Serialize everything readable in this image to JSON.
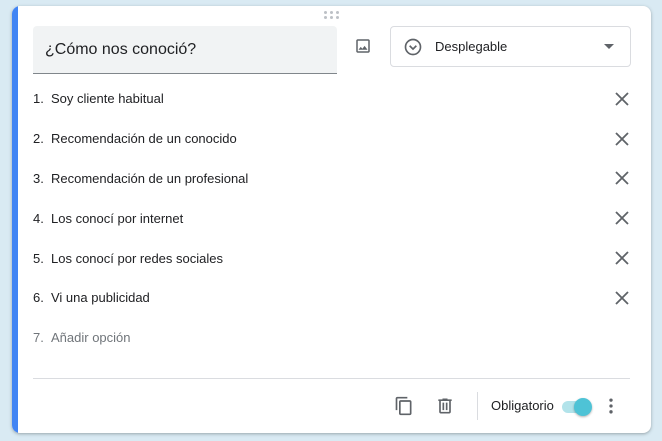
{
  "question": {
    "title": "¿Cómo nos conoció?",
    "type_label": "Desplegable"
  },
  "options": [
    {
      "num": "1.",
      "text": "Soy cliente habitual"
    },
    {
      "num": "2.",
      "text": "Recomendación de un conocido"
    },
    {
      "num": "3.",
      "text": "Recomendación de un profesional"
    },
    {
      "num": "4.",
      "text": "Los conocí por internet"
    },
    {
      "num": "5.",
      "text": "Los conocí por redes sociales"
    },
    {
      "num": "6.",
      "text": "Vi una publicidad"
    }
  ],
  "add_option": {
    "num": "7.",
    "text": "Añadir opción"
  },
  "footer": {
    "required_label": "Obligatorio",
    "required": true
  },
  "icons": {
    "image": "image-icon",
    "type": "dropdown-circle-icon",
    "remove": "close-icon",
    "duplicate": "copy-icon",
    "delete": "trash-icon",
    "more": "more-vert-icon"
  },
  "colors": {
    "accent": "#4285f4",
    "toggle_on": "#4ec3d6"
  }
}
